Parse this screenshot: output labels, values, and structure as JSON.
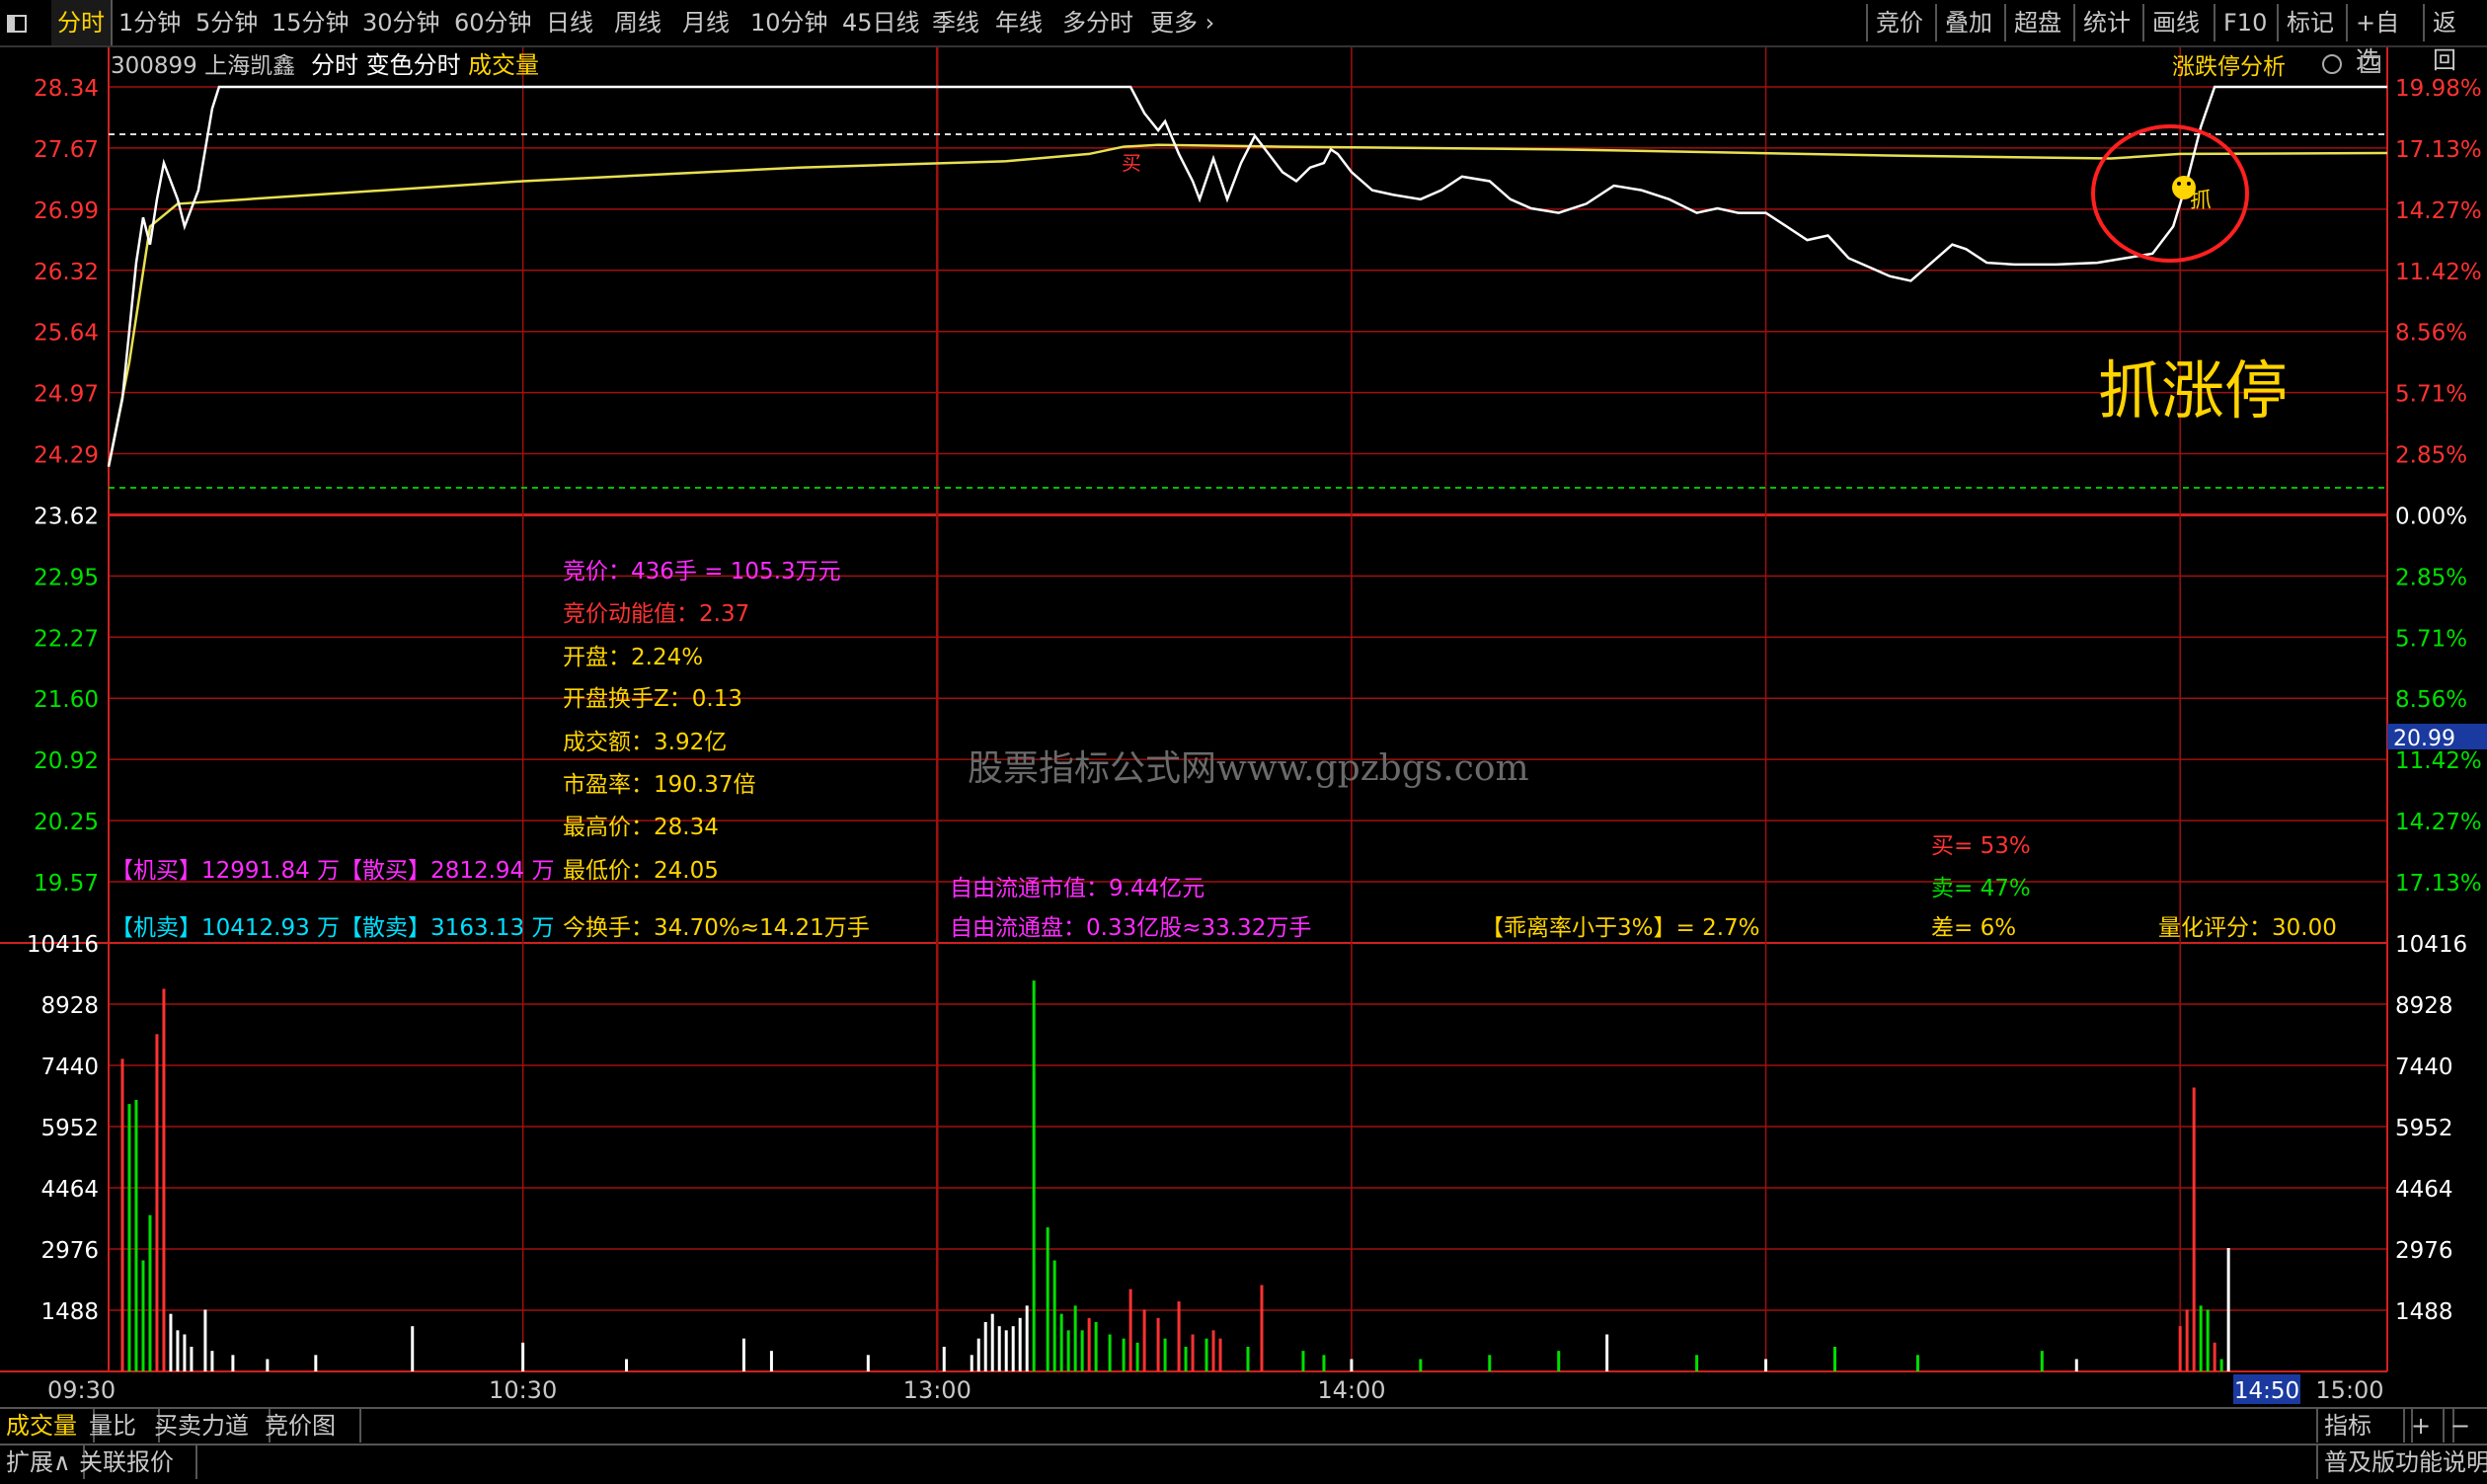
{
  "topbar": {
    "left_items": [
      "分时",
      "1分钟",
      "5分钟",
      "15分钟",
      "30分钟",
      "60分钟",
      "日线",
      "周线",
      "月线",
      "10分钟",
      "45日线",
      "季线",
      "年线",
      "多分时",
      "更多 ›"
    ],
    "right_items": [
      "竞价",
      "叠加",
      "超盘",
      "统计",
      "画线",
      "F10",
      "标记",
      "+自选",
      "返回"
    ]
  },
  "header": {
    "code_name": "300899 上海凯鑫",
    "mode": "分时 变色分时",
    "indicator": "成交量",
    "zt_analysis": "涨跌停分析"
  },
  "chart_data": {
    "type": "line",
    "price_axis": {
      "left_labels": [
        "28.34",
        "27.67",
        "26.99",
        "26.32",
        "25.64",
        "24.97",
        "24.29",
        "23.62",
        "22.95",
        "22.27",
        "21.60",
        "20.92",
        "20.25",
        "19.57"
      ],
      "right_labels": [
        "19.98%",
        "17.13%",
        "14.27%",
        "11.42%",
        "8.56%",
        "5.71%",
        "2.85%",
        "0.00%",
        "2.85%",
        "5.71%",
        "8.56%",
        "11.42%",
        "14.27%",
        "17.13%"
      ],
      "ylim": [
        19.57,
        28.34
      ],
      "prev_close": 23.62,
      "limit_up": 28.34,
      "cursor_price": "20.99"
    },
    "time_axis": {
      "labels": [
        "09:30",
        "10:30",
        "13:00",
        "14:00",
        "15:00"
      ],
      "cursor_time": "14:50"
    },
    "volume_axis": {
      "labels": [
        "10416",
        "8928",
        "7440",
        "5952",
        "4464",
        "2976",
        "1488"
      ],
      "ylim": [
        0,
        10416
      ]
    },
    "price_series": [
      [
        0,
        24.15
      ],
      [
        2,
        24.9
      ],
      [
        4,
        26.4
      ],
      [
        5,
        26.9
      ],
      [
        6,
        26.6
      ],
      [
        7,
        27.1
      ],
      [
        8,
        27.5
      ],
      [
        10,
        27.1
      ],
      [
        11,
        26.8
      ],
      [
        13,
        27.2
      ],
      [
        15,
        28.1
      ],
      [
        16,
        28.34
      ],
      [
        30,
        28.34
      ],
      [
        60,
        28.34
      ],
      [
        100,
        28.34
      ],
      [
        148,
        28.34
      ],
      [
        150,
        28.05
      ],
      [
        152,
        27.86
      ],
      [
        153,
        27.96
      ],
      [
        155,
        27.6
      ],
      [
        157,
        27.3
      ],
      [
        158,
        27.1
      ],
      [
        160,
        27.55
      ],
      [
        162,
        27.1
      ],
      [
        164,
        27.5
      ],
      [
        166,
        27.8
      ],
      [
        168,
        27.6
      ],
      [
        170,
        27.4
      ],
      [
        172,
        27.3
      ],
      [
        174,
        27.45
      ],
      [
        176,
        27.5
      ],
      [
        177,
        27.65
      ],
      [
        178,
        27.6
      ],
      [
        180,
        27.4
      ],
      [
        183,
        27.2
      ],
      [
        186,
        27.15
      ],
      [
        190,
        27.1
      ],
      [
        193,
        27.2
      ],
      [
        196,
        27.35
      ],
      [
        200,
        27.3
      ],
      [
        203,
        27.1
      ],
      [
        206,
        27.0
      ],
      [
        210,
        26.95
      ],
      [
        214,
        27.05
      ],
      [
        218,
        27.25
      ],
      [
        222,
        27.2
      ],
      [
        226,
        27.1
      ],
      [
        230,
        26.95
      ],
      [
        233,
        27.0
      ],
      [
        236,
        26.95
      ],
      [
        240,
        26.95
      ],
      [
        243,
        26.8
      ],
      [
        246,
        26.65
      ],
      [
        249,
        26.7
      ],
      [
        252,
        26.45
      ],
      [
        255,
        26.35
      ],
      [
        258,
        26.25
      ],
      [
        261,
        26.2
      ],
      [
        264,
        26.4
      ],
      [
        267,
        26.6
      ],
      [
        269,
        26.55
      ],
      [
        272,
        26.4
      ],
      [
        276,
        26.38
      ],
      [
        282,
        26.38
      ],
      [
        288,
        26.4
      ],
      [
        292,
        26.45
      ],
      [
        296,
        26.5
      ],
      [
        299,
        26.8
      ],
      [
        301,
        27.3
      ],
      [
        303,
        27.9
      ],
      [
        305,
        28.34
      ],
      [
        315,
        28.34
      ],
      [
        330,
        28.34
      ]
    ],
    "avg_series": [
      [
        0,
        24.15
      ],
      [
        3,
        25.3
      ],
      [
        6,
        26.8
      ],
      [
        10,
        27.05
      ],
      [
        20,
        27.1
      ],
      [
        60,
        27.3
      ],
      [
        100,
        27.45
      ],
      [
        130,
        27.52
      ],
      [
        142,
        27.6
      ],
      [
        147,
        27.68
      ],
      [
        152,
        27.7
      ],
      [
        170,
        27.68
      ],
      [
        210,
        27.65
      ],
      [
        260,
        27.58
      ],
      [
        290,
        27.55
      ],
      [
        300,
        27.6
      ],
      [
        330,
        27.61
      ]
    ],
    "volume_red": [
      [
        2,
        7600
      ],
      [
        7,
        8200
      ],
      [
        8,
        9300
      ],
      [
        142,
        1300
      ],
      [
        148,
        2000
      ],
      [
        150,
        1500
      ],
      [
        152,
        1300
      ],
      [
        155,
        1700
      ],
      [
        157,
        900
      ],
      [
        160,
        1000
      ],
      [
        161,
        800
      ],
      [
        167,
        2100
      ],
      [
        300,
        1100
      ],
      [
        301,
        1500
      ],
      [
        302,
        6900
      ],
      [
        305,
        700
      ]
    ],
    "volume_green": [
      [
        3,
        6500
      ],
      [
        4,
        6600
      ],
      [
        5,
        2700
      ],
      [
        6,
        3800
      ],
      [
        134,
        9500
      ],
      [
        136,
        3500
      ],
      [
        137,
        2700
      ],
      [
        138,
        1400
      ],
      [
        139,
        1000
      ],
      [
        140,
        1600
      ],
      [
        141,
        1000
      ],
      [
        143,
        1200
      ],
      [
        145,
        900
      ],
      [
        147,
        800
      ],
      [
        149,
        700
      ],
      [
        153,
        800
      ],
      [
        156,
        600
      ],
      [
        159,
        800
      ],
      [
        165,
        600
      ],
      [
        173,
        500
      ],
      [
        176,
        400
      ],
      [
        190,
        300
      ],
      [
        200,
        400
      ],
      [
        210,
        500
      ],
      [
        230,
        400
      ],
      [
        250,
        600
      ],
      [
        262,
        400
      ],
      [
        280,
        500
      ],
      [
        303,
        1600
      ],
      [
        304,
        1500
      ],
      [
        306,
        300
      ]
    ],
    "volume_white": [
      [
        9,
        1400
      ],
      [
        10,
        1000
      ],
      [
        11,
        900
      ],
      [
        12,
        600
      ],
      [
        14,
        1500
      ],
      [
        15,
        500
      ],
      [
        18,
        400
      ],
      [
        23,
        300
      ],
      [
        30,
        400
      ],
      [
        44,
        1100
      ],
      [
        60,
        700
      ],
      [
        75,
        300
      ],
      [
        92,
        800
      ],
      [
        96,
        500
      ],
      [
        110,
        400
      ],
      [
        121,
        600
      ],
      [
        125,
        400
      ],
      [
        126,
        800
      ],
      [
        127,
        1200
      ],
      [
        128,
        1400
      ],
      [
        129,
        1100
      ],
      [
        130,
        1000
      ],
      [
        131,
        1100
      ],
      [
        132,
        1300
      ],
      [
        133,
        1600
      ],
      [
        180,
        300
      ],
      [
        217,
        900
      ],
      [
        240,
        300
      ],
      [
        285,
        300
      ],
      [
        307,
        3000
      ]
    ]
  },
  "info": {
    "jingjia": "竞价：436手 = 105.3万元",
    "jingjia_dongneng": "竞价动能值：2.37",
    "kaipan": "开盘：2.24%",
    "kaipan_huanshou": "开盘换手Z：0.13",
    "chengjiao": "成交额：3.92亿",
    "shiying": "市盈率：190.37倍",
    "zuigao": "最高价：28.34",
    "zuidi": "最低价：24.05",
    "jimai": "【机买】12991.84 万【散买】2812.94 万",
    "jimai2": "【机卖】10412.93 万【散卖】3163.13 万",
    "huanshou": "今换手：34.70%≈14.21万手",
    "ziyou_shizhi": "自由流通市值：9.44亿元",
    "ziyou_pan": "自由流通盘：0.33亿股≈33.32万手",
    "guaili": "【乖离率小于3%】= 2.7%",
    "mai": "买= 53%",
    "mai2": "卖= 47%",
    "cha": "差= 6%",
    "liangping": "量化评分：30.00",
    "watermark": "股票指标公式网www.gpzbgs.com",
    "big_label": "抓涨停",
    "mark_zhua": "抓",
    "mark_b": "买"
  },
  "bottombar": {
    "tabs": [
      "成交量",
      "量比",
      "买卖力道",
      "竞价图"
    ],
    "right": [
      "指标",
      "+",
      "−"
    ],
    "row2_left": [
      "扩展∧",
      "关联报价"
    ],
    "row2_right": "普及版功能说明"
  },
  "colors": {
    "red": "#ff3232",
    "green": "#00e000",
    "yellow": "#ffd400",
    "magenta": "#ff2cff",
    "cyan": "#00e0ff",
    "grid": "#a01010",
    "white": "#ffffff",
    "bg": "#000000",
    "avg": "#e8e050"
  }
}
